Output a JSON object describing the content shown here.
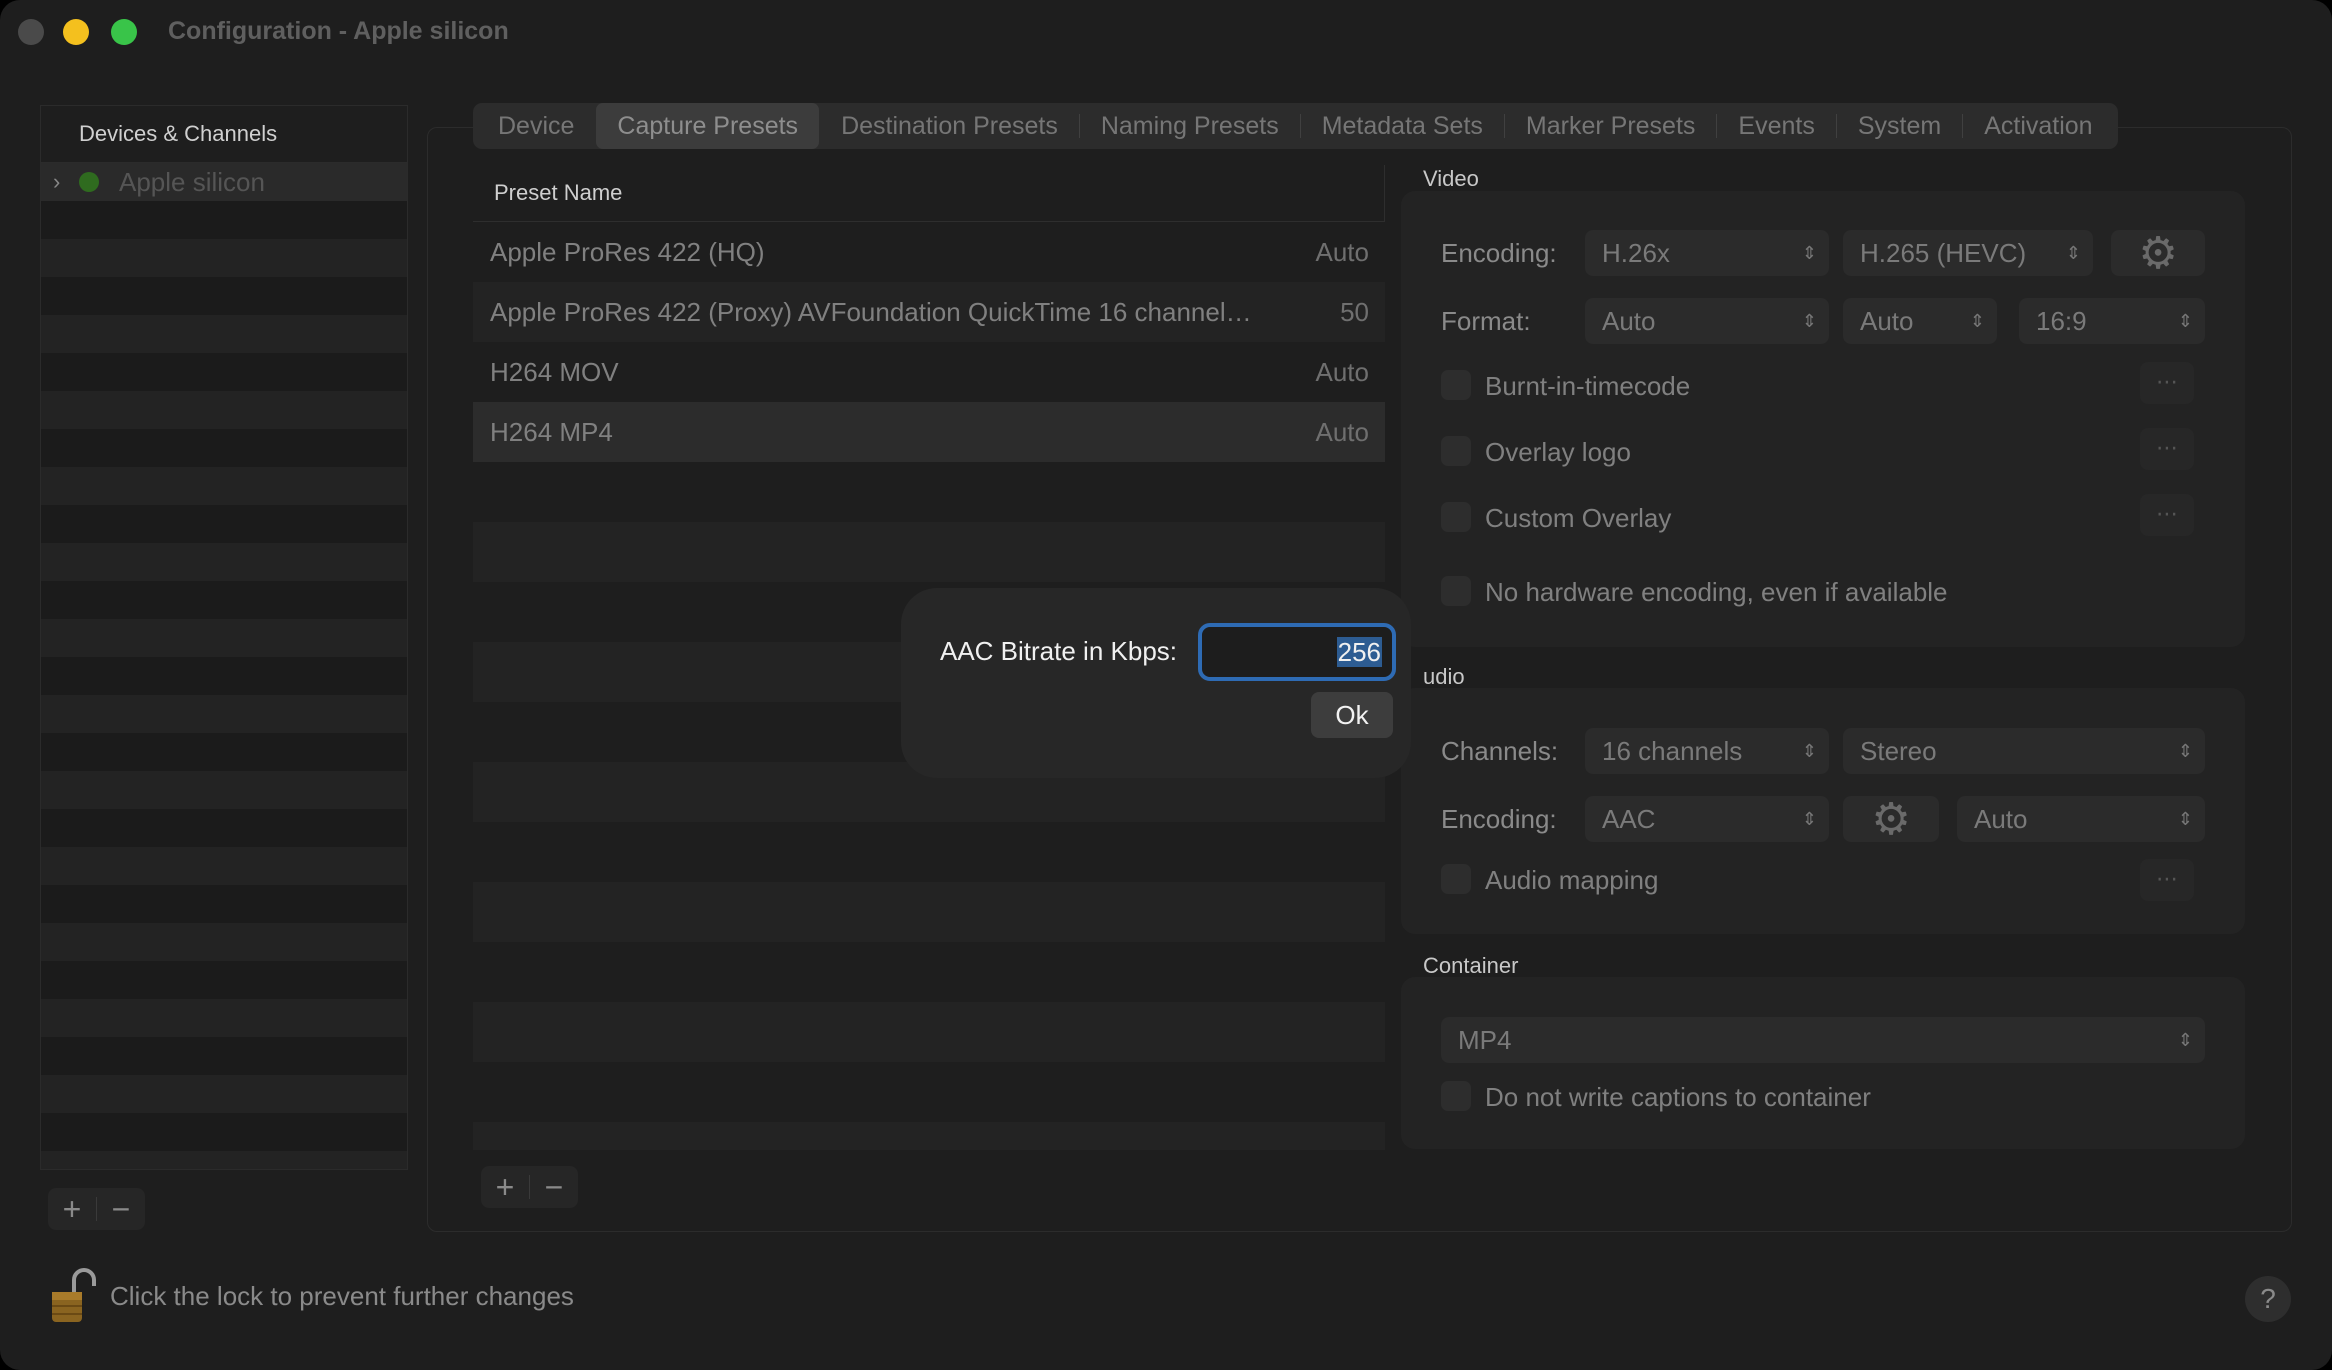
{
  "window": {
    "title": "Configuration - Apple silicon"
  },
  "sidebar": {
    "header": "Devices & Channels",
    "devices": [
      {
        "label": "Apple silicon",
        "status_color": "#2f6b1f"
      }
    ],
    "add_label": "+",
    "remove_label": "−"
  },
  "tabs": [
    {
      "label": "Device",
      "active": false
    },
    {
      "label": "Capture Presets",
      "active": true
    },
    {
      "label": "Destination Presets",
      "active": false
    },
    {
      "label": "Naming Presets",
      "active": false
    },
    {
      "label": "Metadata Sets",
      "active": false
    },
    {
      "label": "Marker Presets",
      "active": false
    },
    {
      "label": "Events",
      "active": false
    },
    {
      "label": "System",
      "active": false
    },
    {
      "label": "Activation",
      "active": false
    }
  ],
  "presets": {
    "column_header": "Preset Name",
    "rows": [
      {
        "name": "Apple ProRes 422 (HQ)",
        "value": "Auto"
      },
      {
        "name": "Apple ProRes 422 (Proxy) AVFoundation QuickTime 16 channel…",
        "value": "50"
      },
      {
        "name": "H264 MOV",
        "value": "Auto"
      },
      {
        "name": "H264 MP4",
        "value": "Auto"
      }
    ],
    "add_label": "+",
    "remove_label": "−"
  },
  "video": {
    "section_label": "Video",
    "encoding_label": "Encoding:",
    "encoding_value": "H.26x",
    "codec_value": "H.265 (HEVC)",
    "format_label": "Format:",
    "format_value": "Auto",
    "format_value2": "Auto",
    "aspect_value": "16:9",
    "burnt_in_label": "Burnt-in-timecode",
    "overlay_logo_label": "Overlay logo",
    "custom_overlay_label": "Custom Overlay",
    "no_hw_label": "No hardware encoding, even if available"
  },
  "audio": {
    "section_label": "udio",
    "channels_label": "Channels:",
    "channels_value": "16 channels",
    "stereo_value": "Stereo",
    "encoding_label": "Encoding:",
    "encoding_value": "AAC",
    "bitrate_value": "Auto",
    "mapping_label": "Audio mapping"
  },
  "container": {
    "section_label": "Container",
    "format_value": "MP4",
    "no_captions_label": "Do not write captions to container"
  },
  "footer": {
    "lock_text": "Click the lock to prevent further changes",
    "help_label": "?"
  },
  "dialog": {
    "label": "AAC Bitrate in Kbps:",
    "input_value": "256",
    "ok_label": "Ok",
    "focus_color": "#2e6bb4"
  }
}
